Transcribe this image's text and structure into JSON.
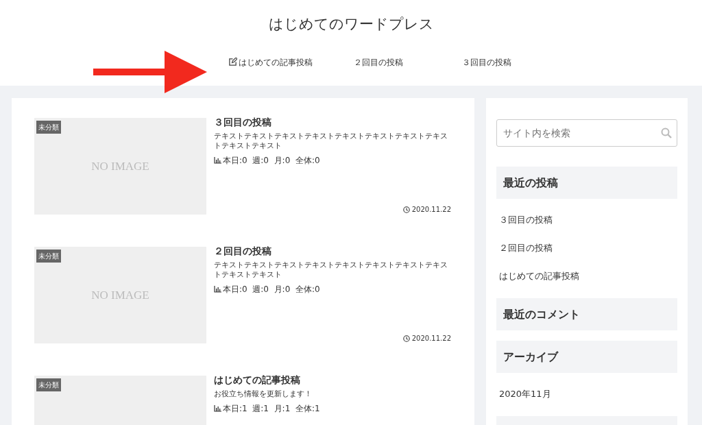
{
  "site_title": "はじめてのワードプレス",
  "nav": [
    {
      "label": "はじめての記事投稿",
      "kind": "with-icon"
    },
    {
      "label": "２回目の投稿",
      "kind": "plain"
    },
    {
      "label": "３回目の投稿",
      "kind": "plain"
    }
  ],
  "posts": [
    {
      "category": "未分類",
      "thumbnail_text": "NO IMAGE",
      "title": "３回目の投稿",
      "excerpt": "テキストテキストテキストテキストテキストテキストテキストテキストテキストテキスト",
      "stats": "本日:0  週:0  月:0  全体:0",
      "date": "2020.11.22"
    },
    {
      "category": "未分類",
      "thumbnail_text": "NO IMAGE",
      "title": "２回目の投稿",
      "excerpt": "テキストテキストテキストテキストテキストテキストテキストテキストテキストテキスト",
      "stats": "本日:0  週:0  月:0  全体:0",
      "date": "2020.11.22"
    },
    {
      "category": "未分類",
      "title": "はじめての記事投稿",
      "excerpt": "お役立ち情報を更新します！",
      "stats": "本日:1  週:1  月:1  全体:1"
    }
  ],
  "sidebar": [
    {
      "kind": "search",
      "placeholder": "サイト内を検索"
    },
    {
      "kind": "list",
      "title": "最近の投稿",
      "items": [
        "３回目の投稿",
        "２回目の投稿",
        "はじめての記事投稿"
      ]
    },
    {
      "kind": "list",
      "title": "最近のコメント"
    },
    {
      "kind": "list",
      "title": "アーカイブ",
      "items": [
        "2020年11月"
      ]
    }
  ]
}
